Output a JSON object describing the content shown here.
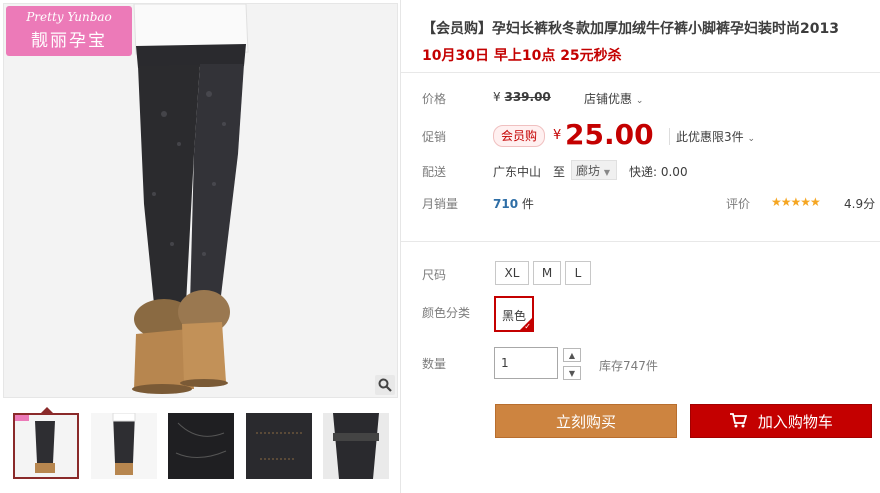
{
  "gallery": {
    "logo_en": "Pretty Yunbao",
    "logo_cn": "靓丽孕宝",
    "zoom_icon": "magnifier-icon",
    "thumbnail_count": 5
  },
  "product": {
    "title": "【会员购】孕妇长裤秋冬款加厚加绒牛仔裤小脚裤孕妇装时尚2013",
    "subtitle": "10月30日 早上10点 25元秒杀"
  },
  "price": {
    "label": "价格",
    "currency": "¥",
    "original": "339.00",
    "shop_promo": "店铺优惠"
  },
  "promo": {
    "label": "促销",
    "tag": "会员购",
    "currency": "¥",
    "price": "25.00",
    "limit": "此优惠限3件"
  },
  "shipping": {
    "label": "配送",
    "from": "广东中山",
    "to_word": "至",
    "destination": "廊坊",
    "express": "快递: 0.00"
  },
  "sales": {
    "label": "月销量",
    "count": "710",
    "unit": "件",
    "rating_label": "评价",
    "stars": "★★★★★",
    "score": "4.9分",
    "rating_value": 4.9
  },
  "options": {
    "size_label": "尺码",
    "sizes": [
      "XL",
      "M",
      "L"
    ],
    "color_label": "颜色分类",
    "color": "黑色",
    "qty_label": "数量",
    "qty": "1",
    "stock": "库存747件"
  },
  "actions": {
    "buy": "立刻购买",
    "cart": "加入购物车"
  },
  "colors": {
    "accent_red": "#c40000",
    "buy_orange": "#cd8440",
    "logo_pink": "#ec7ab8"
  }
}
